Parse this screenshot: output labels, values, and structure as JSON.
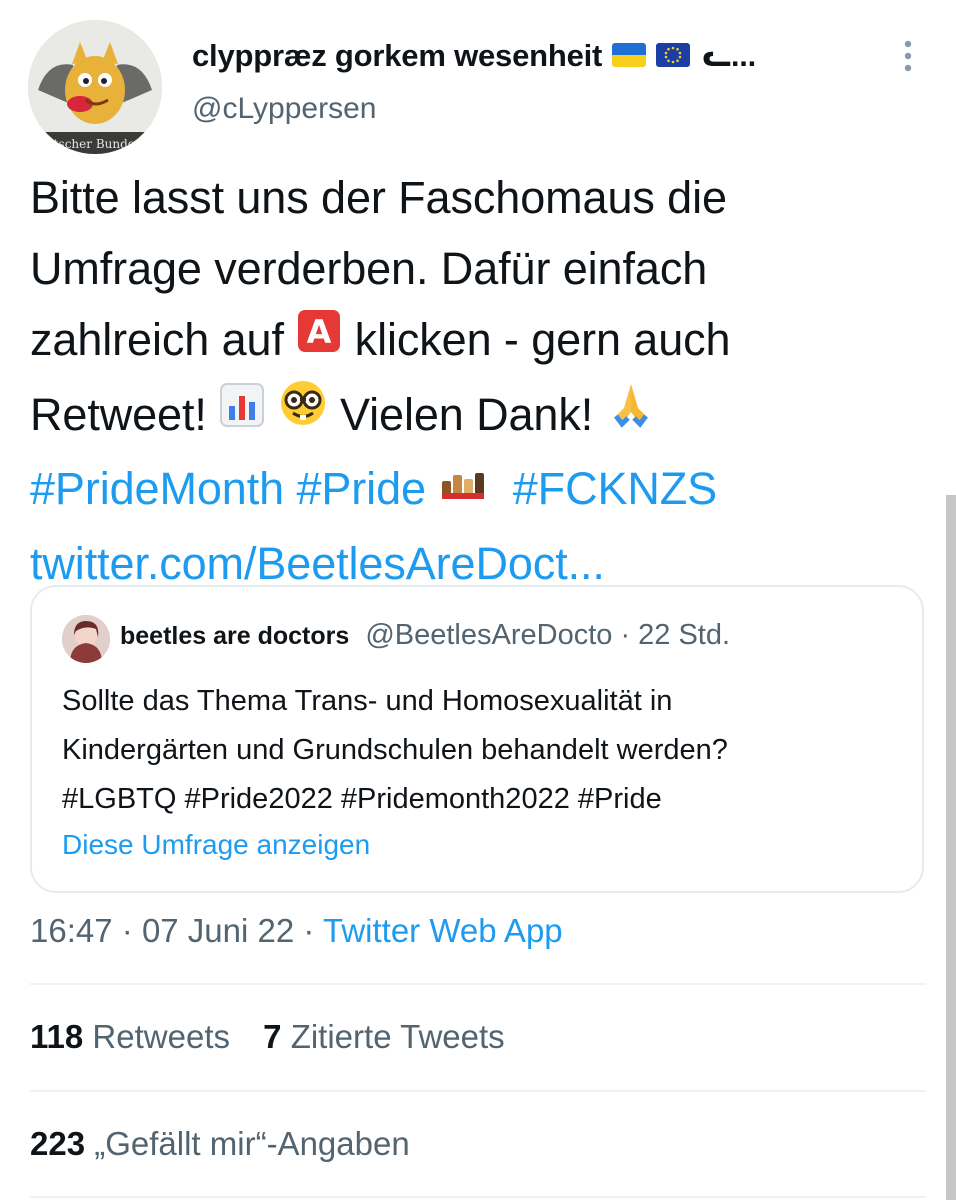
{
  "author": {
    "display_name": "clyppræz gorkem wesenheit",
    "name_tail": "ᓚ...",
    "handle": "@cLyppersen",
    "avatar_caption": "Deutscher Bundestag"
  },
  "tweet": {
    "lines": [
      "Bitte lasst uns der Faschomaus die",
      "Umfrage verderben. Dafür einfach"
    ],
    "line3_a": "zahlreich auf",
    "line3_b": "klicken - gern auch",
    "line4_a": "Retweet!",
    "line4_b": "Vielen Dank!",
    "hashtags": [
      "#PrideMonth",
      "#Pride",
      "#FCKNZS"
    ],
    "link": "twitter.com/BeetlesAreDoct..."
  },
  "quote": {
    "name": "beetles are doctors",
    "meta": "@BeetlesAreDocto · 22 Std.",
    "lines": [
      "Sollte das Thema Trans- und Homosexualität in",
      "Kindergärten und Grundschulen behandelt werden?",
      "#LGBTQ #Pride2022 #Pridemonth2022 #Pride"
    ],
    "poll_link": "Diese Umfrage anzeigen"
  },
  "meta": {
    "time": "16:47",
    "date": "07 Juni 22",
    "source": "Twitter Web App"
  },
  "stats": {
    "retweets_count": "118",
    "retweets_label": "Retweets",
    "quotes_count": "7",
    "quotes_label": "Zitierte Tweets",
    "likes_count": "223",
    "likes_label": "„Gefällt mir“-Angaben"
  },
  "icons": {
    "flag_1": "ukraine-flag-icon",
    "flag_2": "eu-flag-icon",
    "emoji_a": "a-button-icon",
    "emoji_chart": "bar-chart-icon",
    "emoji_nerd": "nerd-face-icon",
    "emoji_pray": "folded-hands-icon",
    "emoji_hands": "raised-fists-icon",
    "more": "more-dots-icon"
  },
  "colors": {
    "link": "#1d9bf0",
    "text": "#0f1419",
    "secondary": "#536471",
    "border": "#e6ebee"
  }
}
